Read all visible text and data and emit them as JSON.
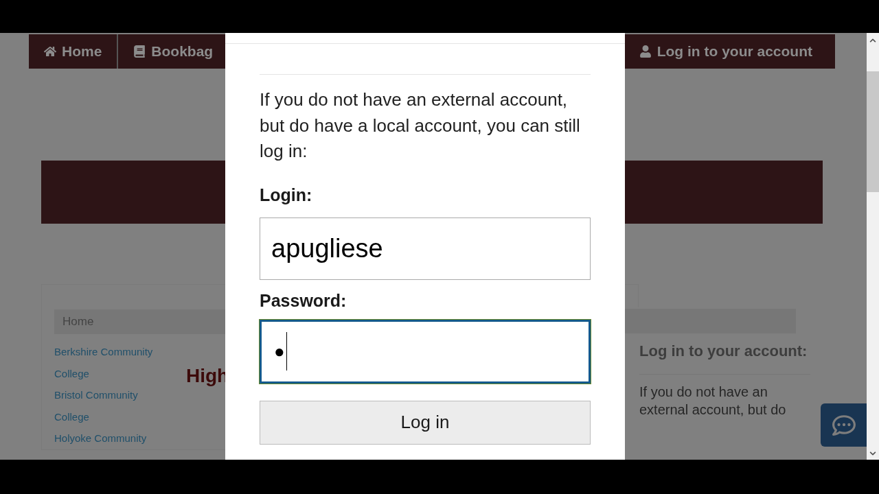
{
  "nav": [
    {
      "kind": "home",
      "label": "Home"
    },
    {
      "kind": "book",
      "label": "Bookbag"
    },
    {
      "kind": "user",
      "label": "Log in to your account"
    }
  ],
  "breadcrumb": "Home",
  "sidebar_links": [
    "Berkshire Community",
    "College",
    "Bristol Community",
    "College",
    "Holyoke Community"
  ],
  "heading_cut": "High",
  "right_panel": {
    "title": "Log in to your account:",
    "text": "If you do not have an",
    "text_cut": "external account, but do"
  },
  "modal": {
    "intro": "If you do not have an external account, but do have a local account, you can still log in:",
    "login_label": "Login:",
    "login_value": "apugliese",
    "password_label": "Password:",
    "password_value": "●",
    "password_focused": true,
    "submit": "Log in"
  }
}
